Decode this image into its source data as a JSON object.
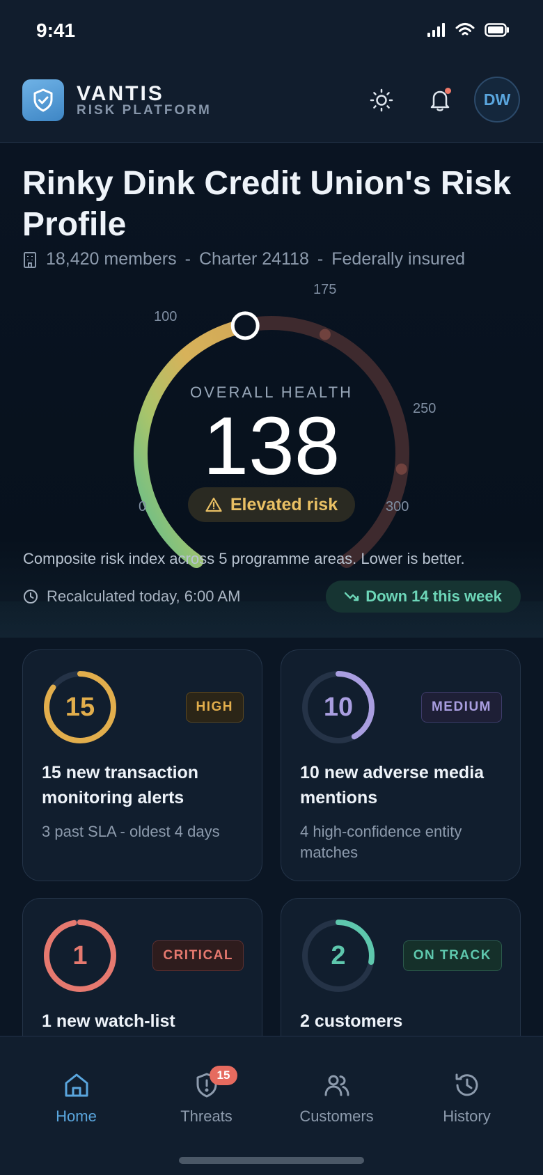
{
  "status": {
    "time": "9:41"
  },
  "brand": {
    "name": "VANTIS",
    "sub": "RISK PLATFORM",
    "user_initials": "DW"
  },
  "hero": {
    "title": "Rinky Dink Credit Union's Risk Profile",
    "members": "18,420 members",
    "charter": "Charter 24118",
    "insured": "Federally insured",
    "separator": "-"
  },
  "gauge": {
    "label": "OVERALL HEALTH",
    "value": "138",
    "score": 138,
    "min": 0,
    "max": 300,
    "risk_label": "Elevated risk",
    "ticks": [
      "0",
      "100",
      "175",
      "250",
      "300"
    ]
  },
  "summary": {
    "composite": "Composite risk index across 5 programme areas. Lower is better.",
    "recalculated": "Recalculated today, 6:00 AM",
    "trend": "Down 14 this week"
  },
  "cards": [
    {
      "count": "15",
      "badge": "HIGH",
      "title": "15 new transaction monitoring alerts",
      "sub": "3 past SLA - oldest 4 days",
      "color": "#e2ae4c",
      "fill": 0.85
    },
    {
      "count": "10",
      "badge": "MEDIUM",
      "title": "10 new adverse media mentions",
      "sub": "4 high-confidence entity matches",
      "color": "#a99ee0",
      "fill": 0.42
    },
    {
      "count": "1",
      "badge": "CRITICAL",
      "title": "1 new watch-list",
      "sub": "",
      "color": "#e6796f",
      "fill": 0.97
    },
    {
      "count": "2",
      "badge": "ON TRACK",
      "title": "2 customers",
      "sub": "",
      "color": "#5ec7ad",
      "fill": 0.28
    }
  ],
  "nav": {
    "home": "Home",
    "threats": "Threats",
    "threats_badge": "15",
    "customers": "Customers",
    "history": "History"
  },
  "colors": {
    "accent": "#5aa6de",
    "high": "#e2ae4c",
    "medium": "#a99ee0",
    "critical": "#e6796f",
    "on_track": "#5ec7ad"
  }
}
